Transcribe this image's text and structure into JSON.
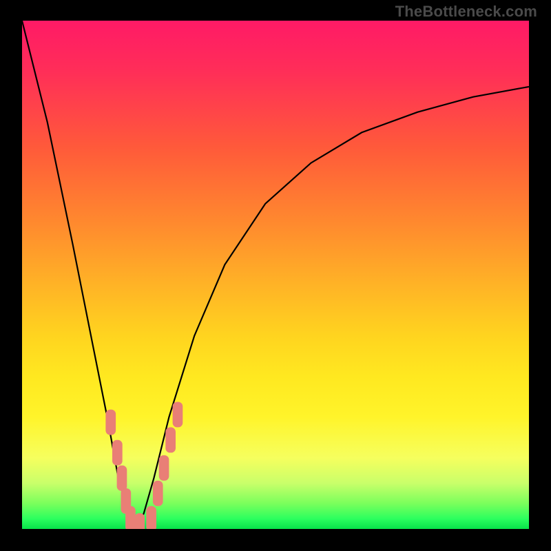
{
  "watermark": "TheBottleneck.com",
  "chart_data": {
    "type": "line",
    "title": "",
    "xlabel": "",
    "ylabel": "",
    "legend": [],
    "x_range": [
      0,
      1
    ],
    "y_range": [
      0,
      1
    ],
    "grid": false,
    "background": "red-yellow-green vertical gradient",
    "series": [
      {
        "name": "bottleneck-curve",
        "kind": "v-curve",
        "description": "Steep descending left arm meeting a shallow rising right arm forming a V minimum near x≈0.22",
        "x": [
          0.0,
          0.05,
          0.1,
          0.14,
          0.17,
          0.19,
          0.21,
          0.22,
          0.24,
          0.26,
          0.29,
          0.34,
          0.4,
          0.48,
          0.57,
          0.67,
          0.78,
          0.89,
          1.0
        ],
        "y": [
          1.0,
          0.8,
          0.56,
          0.36,
          0.21,
          0.1,
          0.03,
          0.0,
          0.03,
          0.1,
          0.22,
          0.38,
          0.52,
          0.64,
          0.72,
          0.78,
          0.82,
          0.85,
          0.87
        ]
      }
    ],
    "markers": [
      {
        "name": "highlighted-points",
        "shape": "rounded-rect",
        "color": "#e97f76",
        "approx_width": 0.02,
        "approx_height": 0.05,
        "points_xy": [
          [
            0.175,
            0.21
          ],
          [
            0.188,
            0.15
          ],
          [
            0.197,
            0.1
          ],
          [
            0.205,
            0.055
          ],
          [
            0.214,
            0.02
          ],
          [
            0.232,
            0.006
          ],
          [
            0.255,
            0.02
          ],
          [
            0.268,
            0.07
          ],
          [
            0.28,
            0.12
          ],
          [
            0.293,
            0.175
          ],
          [
            0.307,
            0.225
          ]
        ]
      }
    ]
  }
}
